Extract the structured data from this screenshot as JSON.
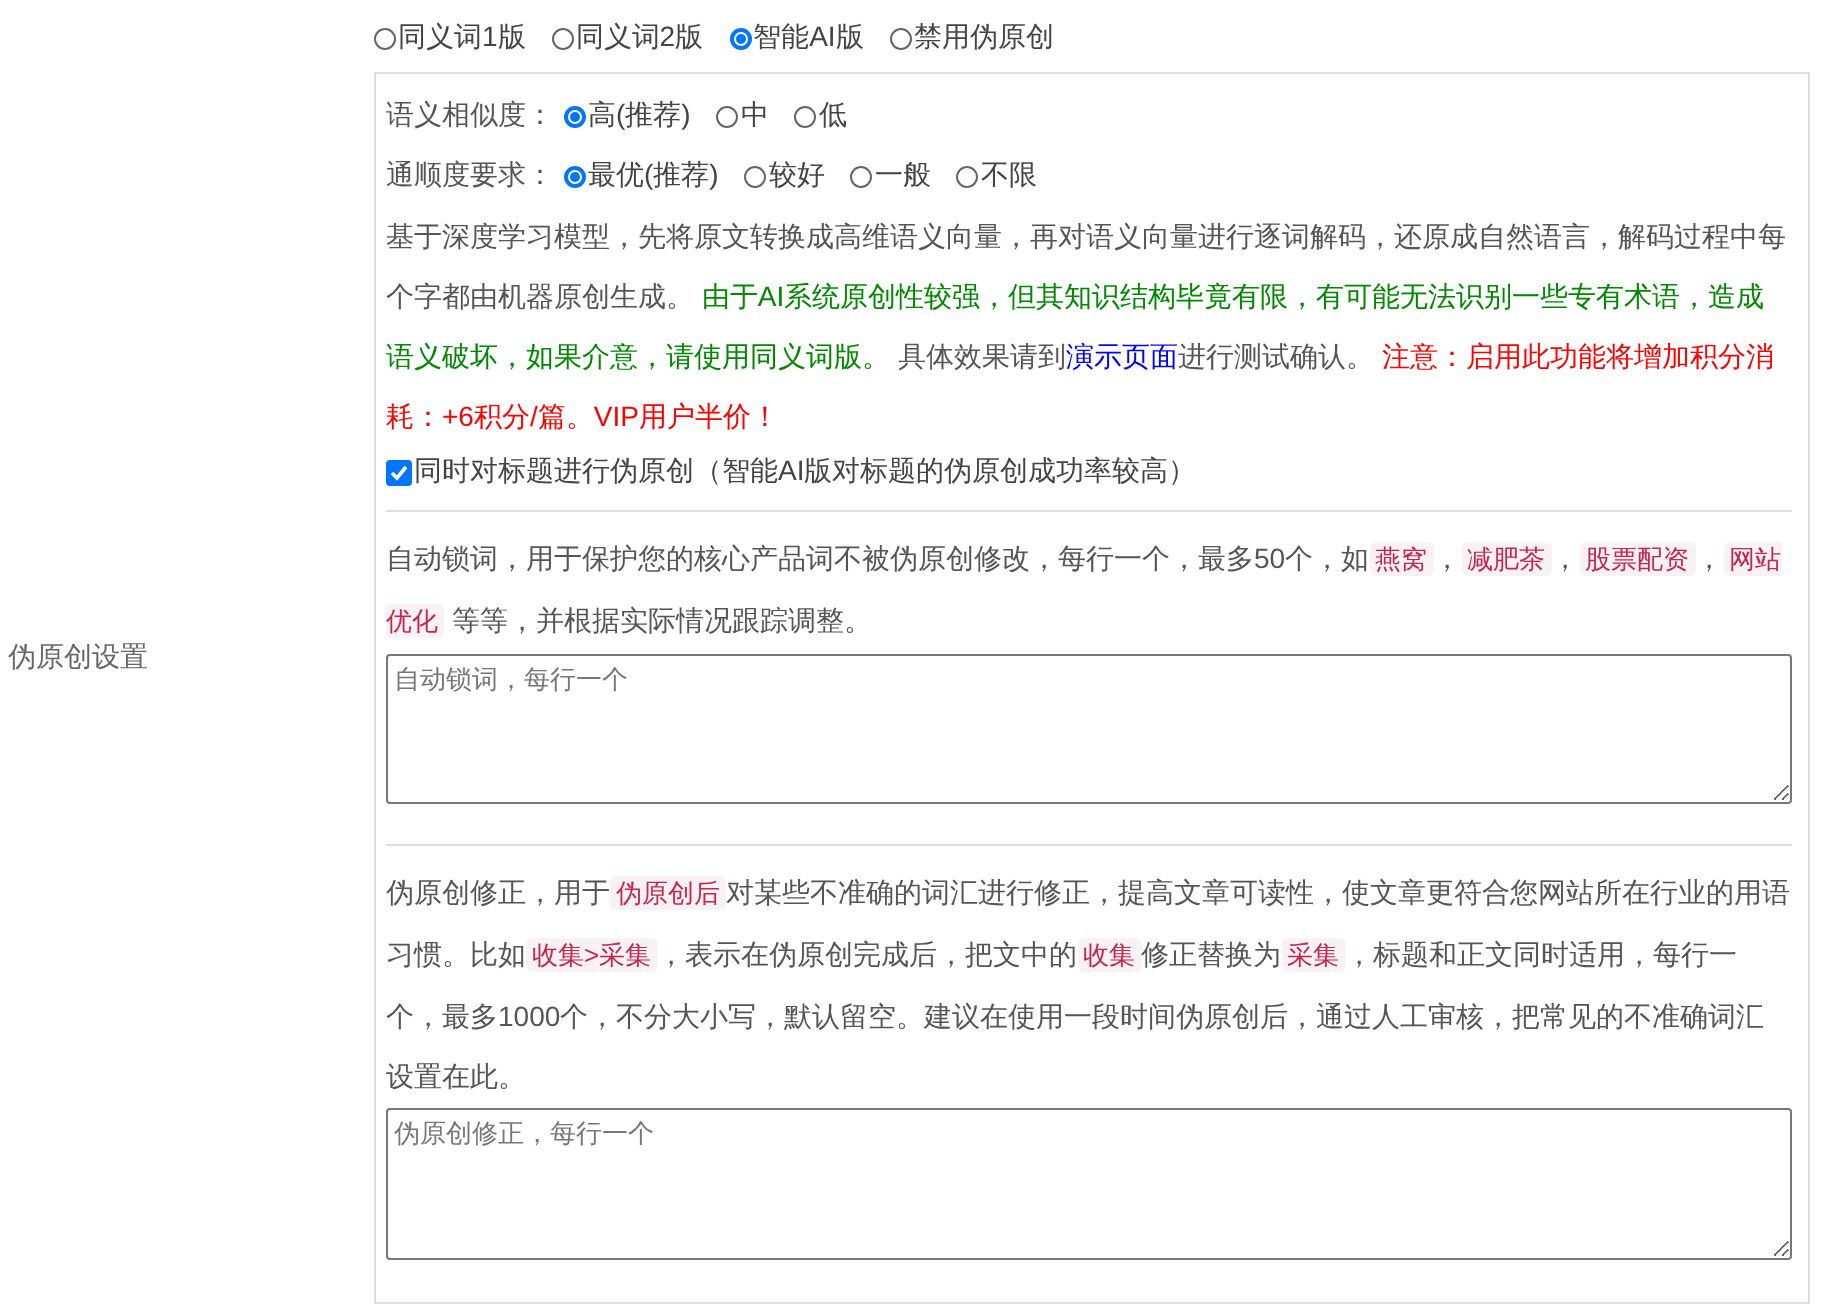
{
  "label": "伪原创设置",
  "modes": [
    {
      "label": "同义词1版",
      "selected": false
    },
    {
      "label": "同义词2版",
      "selected": false
    },
    {
      "label": "智能AI版",
      "selected": true
    },
    {
      "label": "禁用伪原创",
      "selected": false
    }
  ],
  "similarity": {
    "label": "语义相似度：",
    "options": [
      {
        "label": "高(推荐)",
        "selected": true
      },
      {
        "label": "中",
        "selected": false
      },
      {
        "label": "低",
        "selected": false
      }
    ]
  },
  "fluency": {
    "label": "通顺度要求：",
    "options": [
      {
        "label": "最优(推荐)",
        "selected": true
      },
      {
        "label": "较好",
        "selected": false
      },
      {
        "label": "一般",
        "selected": false
      },
      {
        "label": "不限",
        "selected": false
      }
    ]
  },
  "ai_description": [
    {
      "kind": "plain",
      "text": "基于深度学习模型，先将原文转换成高维语义向量，再对语义向量进行逐词解码，还原成自然语言，解码过程中每个字都由机器原创生成。 "
    },
    {
      "kind": "green",
      "text": "由于AI系统原创性较强，但其知识结构毕竟有限，有可能无法识别一些专有术语，造成语义破坏，如果介意，请使用同义词版。"
    },
    {
      "kind": "plain",
      "text": " 具体效果请到"
    },
    {
      "kind": "link",
      "text": "演示页面"
    },
    {
      "kind": "plain",
      "text": "进行测试确认。 "
    },
    {
      "kind": "red",
      "text": "注意：启用此功能将增加积分消耗：+6积分/篇。VIP用户半价！"
    }
  ],
  "title_option": {
    "label": "同时对标题进行伪原创（智能AI版对标题的伪原创成功率较高）",
    "checked": true
  },
  "lock_words": {
    "description": [
      {
        "kind": "plain",
        "text": "自动锁词，用于保护您的核心产品词不被伪原创修改，每行一个，最多50个，如"
      },
      {
        "kind": "tag",
        "text": "燕窝"
      },
      {
        "kind": "plain",
        "text": "，"
      },
      {
        "kind": "tag",
        "text": "减肥茶"
      },
      {
        "kind": "plain",
        "text": "，"
      },
      {
        "kind": "tag",
        "text": "股票配资"
      },
      {
        "kind": "plain",
        "text": "，"
      },
      {
        "kind": "tag",
        "text": "网站优化"
      },
      {
        "kind": "plain",
        "text": " 等等，并根据实际情况跟踪调整。"
      }
    ],
    "placeholder": "自动锁词，每行一个"
  },
  "corrections": {
    "description": [
      {
        "kind": "plain",
        "text": "伪原创修正，用于"
      },
      {
        "kind": "tag",
        "text": "伪原创后"
      },
      {
        "kind": "plain",
        "text": "对某些不准确的词汇进行修正，提高文章可读性，使文章更符合您网站所在行业的用语习惯。比如"
      },
      {
        "kind": "tag",
        "text": "收集>采集"
      },
      {
        "kind": "plain",
        "text": "，表示在伪原创完成后，把文中的"
      },
      {
        "kind": "tag",
        "text": "收集"
      },
      {
        "kind": "plain",
        "text": "修正替换为"
      },
      {
        "kind": "tag",
        "text": "采集"
      },
      {
        "kind": "plain",
        "text": "，标题和正文同时适用，每行一个，最多1000个，不分大小写，默认留空。建议在使用一段时间伪原创后，通过人工审核，把常见的不准确词汇设置在此。"
      }
    ],
    "placeholder": "伪原创修正，每行一个"
  }
}
